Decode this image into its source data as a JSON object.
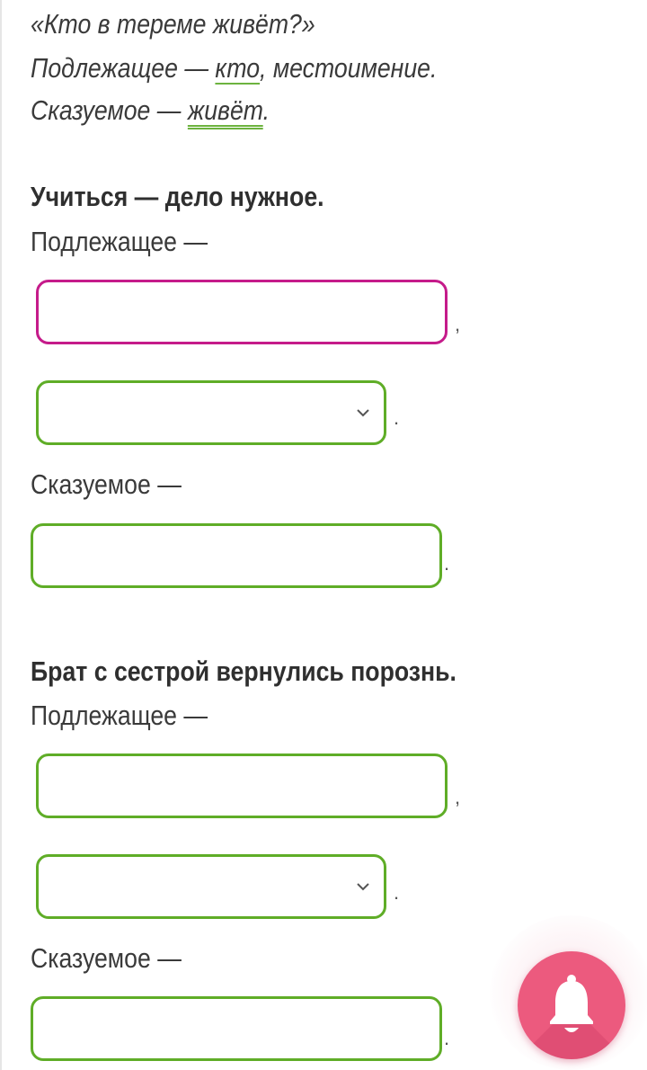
{
  "example": {
    "sentence": "«Кто в тереме живёт?»",
    "subject_prefix": "Подлежащее — ",
    "subject_word": "кто",
    "subject_suffix": ", местоимение.",
    "predicate_prefix": "Сказуемое — ",
    "predicate_word": "живёт",
    "predicate_suffix": "."
  },
  "tasks": [
    {
      "sentence": "Учиться — дело нужное.",
      "subject_label": "Подлежащее —",
      "subject_value": "",
      "subject_sep": ",",
      "pos_value": "",
      "pos_sep": ".",
      "predicate_label": "Сказуемое —",
      "predicate_value": "",
      "predicate_sep": "."
    },
    {
      "sentence": "Брат с сестрой вернулись порознь.",
      "subject_label": "Подлежащее —",
      "subject_value": "",
      "subject_sep": ",",
      "pos_value": "",
      "pos_sep": ".",
      "predicate_label": "Сказуемое —",
      "predicate_value": "",
      "predicate_sep": "."
    }
  ],
  "fab": {
    "icon": "bell-icon",
    "color": "#ec5a7e"
  },
  "colors": {
    "accent_green": "#5fad27",
    "focus_magenta": "#c51b8a",
    "underline_green": "#6db33f"
  }
}
